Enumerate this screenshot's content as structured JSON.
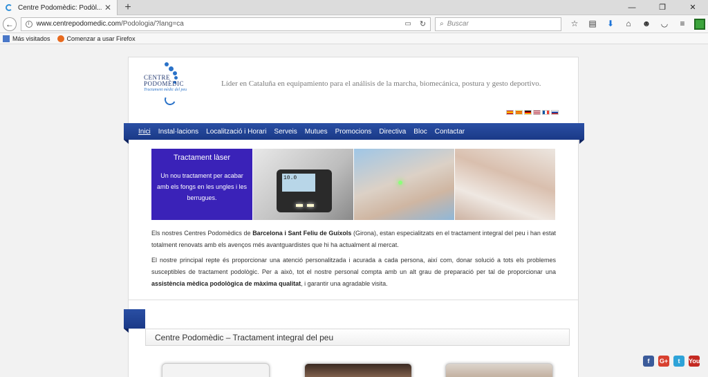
{
  "browser": {
    "tab_title": "Centre Podomèdic: Podòl...",
    "tab_close": "✕",
    "new_tab": "+",
    "url_host": "www.centrepodomedic.com",
    "url_path": "/Podologia/?lang=ca",
    "search_placeholder": "Buscar",
    "bookmarks": [
      "Más visitados",
      "Comenzar a usar Firefox"
    ]
  },
  "header": {
    "logo_line1": "CENTRE",
    "logo_line2": "PODOMÈDIC",
    "logo_sub": "Tractament mèdic del peu",
    "tagline": "Líder en Cataluña en equipamiento para el análisis de la marcha, biomecánica, postura y gesto deportivo."
  },
  "menu": [
    "Inici",
    "Instal·lacions",
    "Localització i Horari",
    "Serveis",
    "Mutues",
    "Promocions",
    "Directiva",
    "Bloc",
    "Contactar"
  ],
  "banner": {
    "title": "Tractament làser",
    "text": "Un nou tractament per acabar amb els fongs en les ungles i les berrugues.",
    "device_display": "10.0"
  },
  "content": {
    "p1_a": "Els nostres Centres Podomèdics de ",
    "p1_b": "Barcelona i Sant Feliu de Guíxols",
    "p1_c": " (Girona), estan especialitzats en el tractament integral del peu i han estat totalment renovats amb els avenços més avantguardistes que hi ha actualment al mercat.",
    "p2_a": "El nostre principal repte és proporcionar una atenció personalitzada i acurada a cada persona, així com, donar solució a tots els problemes susceptibles de tractament podològic. Per a això, tot el nostre personal compta amb un alt grau de preparació per tal de proporcionar una ",
    "p2_b": "assistència mèdica podològica de màxima qualitat",
    "p2_c": ", i garantir una agradable visita."
  },
  "section_title": "Centre Podomèdic – Tractament integral del peu",
  "social": [
    "f",
    "G+",
    "t",
    "You"
  ],
  "colors": {
    "menu": "#1a3987",
    "promo": "#3a22b8",
    "logo": "#2a72c8"
  }
}
